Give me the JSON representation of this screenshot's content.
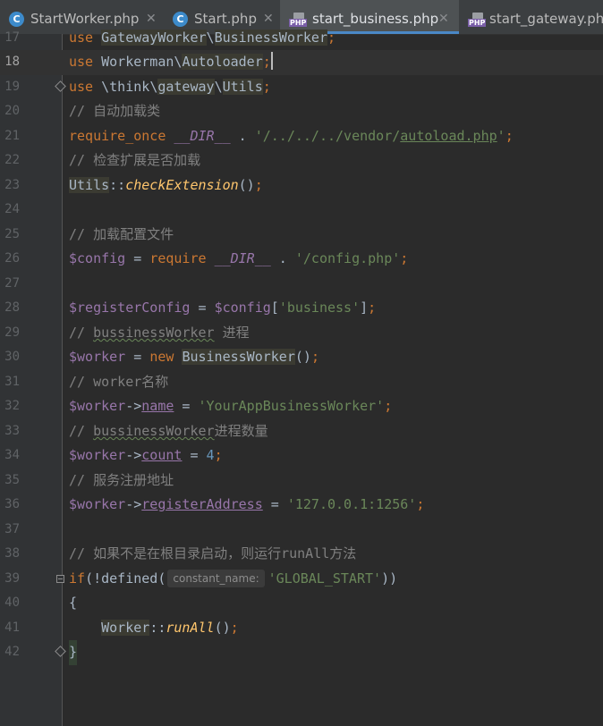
{
  "tabs": [
    {
      "label": "StartWorker.php",
      "icon": "c-class-icon",
      "active": false
    },
    {
      "label": "Start.php",
      "icon": "c-class-icon",
      "active": false
    },
    {
      "label": "start_business.php",
      "icon": "php-file-icon",
      "active": true
    },
    {
      "label": "start_gateway.php",
      "icon": "php-file-icon",
      "active": false
    }
  ],
  "close_glyph": "✕",
  "editor": {
    "lines": [
      {
        "n": "17"
      },
      {
        "n": "18"
      },
      {
        "n": "19"
      },
      {
        "n": "20"
      },
      {
        "n": "21"
      },
      {
        "n": "22"
      },
      {
        "n": "23"
      },
      {
        "n": "24"
      },
      {
        "n": "25"
      },
      {
        "n": "26"
      },
      {
        "n": "27"
      },
      {
        "n": "28"
      },
      {
        "n": "29"
      },
      {
        "n": "30"
      },
      {
        "n": "31"
      },
      {
        "n": "32"
      },
      {
        "n": "33"
      },
      {
        "n": "34"
      },
      {
        "n": "35"
      },
      {
        "n": "36"
      },
      {
        "n": "37"
      },
      {
        "n": "38"
      },
      {
        "n": "39"
      },
      {
        "n": "40"
      },
      {
        "n": "41"
      },
      {
        "n": "42"
      }
    ],
    "t": {
      "use": "use",
      "ns_gw": "GatewayWorker",
      "bslash": "\\",
      "bw": "BusinessWorker",
      "semi": ";",
      "ns_wm": "Workerman",
      "autoloader": "Autoloader",
      "think": "think",
      "gateway": "gateway",
      "utils": "Utils",
      "c20": "// 自动加载类",
      "req_once": "require_once",
      "dir": "__DIR__",
      "dot": " . ",
      "s21a": "'/../../../vendor/",
      "s21b": "autoload.php",
      "s21c": "'",
      "c22": "// 检查扩展是否加载",
      "dcolon": "::",
      "checkExt": "checkExtension",
      "parens": "()",
      "c25": "// 加载配置文件",
      "config": "$config",
      "eq": " = ",
      "require": "require",
      "s26": "'/config.php'",
      "regcfg": "$registerConfig",
      "lb": "[",
      "s28": "'business'",
      "rb": "]",
      "c29a": "// ",
      "c29b": "bussinessWorker",
      "c29c": " 进程",
      "worker": "$worker",
      "new": "new",
      "bwcls": "BusinessWorker",
      "c31": "// worker名称",
      "arrow": "->",
      "name": "name",
      "s32": "'YourAppBusinessWorker'",
      "c33a": "// ",
      "c33b": "bussinessWorker",
      "c33c": "进程数量",
      "count": "count",
      "n34": "4",
      "c35": "// 服务注册地址",
      "regaddr": "registerAddress",
      "s36": "'127.0.0.1:1256'",
      "c38": "// 如果不是在根目录启动，则运行runAll方法",
      "if": "if",
      "ifopen": "(!defined(",
      "hint": "constant_name:",
      "s39": "'GLOBAL_START'",
      "ifclose": "))",
      "lbrace": "{",
      "workercls": "Worker",
      "runAll": "runAll",
      "rbrace": "}"
    }
  },
  "colors": {
    "background": "#2B2B2B",
    "keyword": "#CC7832",
    "string": "#6A8759",
    "variable": "#9876AA",
    "number": "#6897BB",
    "comment": "#808080",
    "function": "#FFC66D",
    "text": "#A9B7C6",
    "tab_accent": "#4A88C7"
  }
}
